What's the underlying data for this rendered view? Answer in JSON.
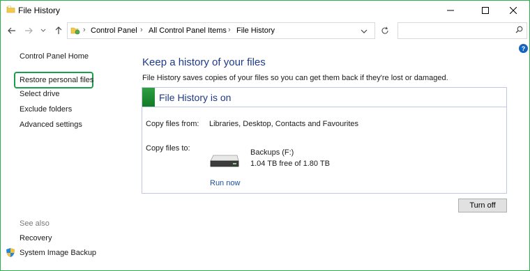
{
  "window": {
    "title": "File History"
  },
  "address": {
    "crumbs": [
      "Control Panel",
      "All Control Panel Items",
      "File History"
    ],
    "search_placeholder": ""
  },
  "sidebar": {
    "home": "Control Panel Home",
    "links": [
      "Restore personal files",
      "Select drive",
      "Exclude folders",
      "Advanced settings"
    ],
    "see_also_label": "See also",
    "see_also": [
      "Recovery",
      "System Image Backup"
    ]
  },
  "main": {
    "heading": "Keep a history of your files",
    "description": "File History saves copies of your files so you can get them back if they're lost or damaged.",
    "status_title": "File History is on",
    "copy_from_label": "Copy files from:",
    "copy_from_value": "Libraries, Desktop, Contacts and Favourites",
    "copy_to_label": "Copy files to:",
    "drive_name": "Backups (F:)",
    "drive_space": "1.04 TB free of 1.80 TB",
    "run_now": "Run now",
    "turn_off": "Turn off"
  },
  "colors": {
    "accent_highlight": "#1a9e4a",
    "window_border": "#2bb04a",
    "status_on": "#2ea043",
    "heading": "#1e3a8a"
  },
  "icons": [
    "folder-icon",
    "minimize-icon",
    "maximize-icon",
    "close-icon",
    "back-arrow-icon",
    "forward-arrow-icon",
    "recent-dropdown-icon",
    "up-arrow-icon",
    "control-panel-icon",
    "dropdown-icon",
    "refresh-icon",
    "search-icon",
    "help-icon",
    "shield-icon",
    "drive-icon"
  ]
}
